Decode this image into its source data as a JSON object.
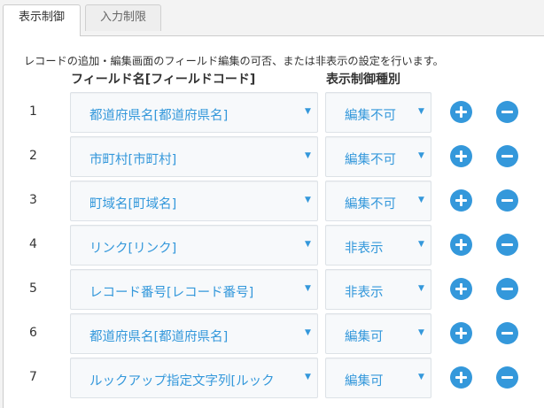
{
  "tabs": [
    {
      "label": "表示制御",
      "active": true
    },
    {
      "label": "入力制限",
      "active": false
    }
  ],
  "instruction": "レコードの追加・編集画面のフィールド編集の可否、または非表示の設定を行います。",
  "headers": {
    "field": "フィールド名[フィールドコード]",
    "control": "表示制御種別"
  },
  "rows": [
    {
      "num": "1",
      "field": "都道府県名[都道府県名]",
      "control": "編集不可"
    },
    {
      "num": "2",
      "field": "市町村[市町村]",
      "control": "編集不可"
    },
    {
      "num": "3",
      "field": "町域名[町域名]",
      "control": "編集不可"
    },
    {
      "num": "4",
      "field": "リンク[リンク]",
      "control": "非表示"
    },
    {
      "num": "5",
      "field": "レコード番号[レコード番号]",
      "control": "非表示"
    },
    {
      "num": "6",
      "field": "都道府県名[都道府県名]",
      "control": "編集可"
    },
    {
      "num": "7",
      "field": "ルックアップ指定文字列[ルック",
      "control": "編集可"
    }
  ],
  "icons": {
    "caret": "caret-down-icon",
    "add": "plus-circle-icon",
    "remove": "minus-circle-icon"
  },
  "colors": {
    "accent": "#3498db",
    "select_bg": "#f7f9fb",
    "panel_bg": "#ffffff",
    "page_bg": "#f3f3f3"
  }
}
